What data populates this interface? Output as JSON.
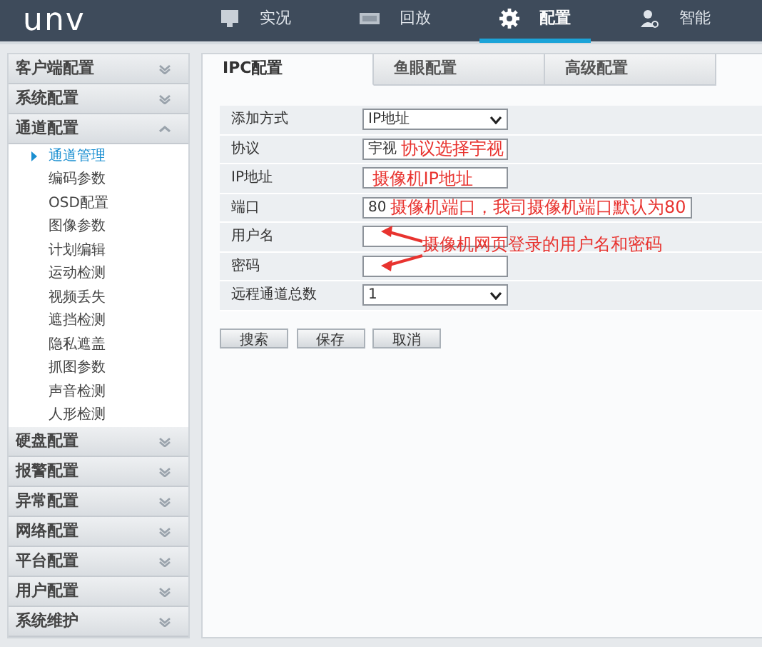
{
  "header": {
    "logo": "unv",
    "nav": [
      {
        "label": "实况",
        "selected": false
      },
      {
        "label": "回放",
        "selected": false
      },
      {
        "label": "配置",
        "selected": true
      },
      {
        "label": "智能",
        "selected": false
      }
    ]
  },
  "sidebar": [
    {
      "label": "客户端配置",
      "expanded": false
    },
    {
      "label": "系统配置",
      "expanded": false
    },
    {
      "label": "通道配置",
      "expanded": true,
      "children": [
        {
          "label": "通道管理",
          "selected": true
        },
        {
          "label": "编码参数",
          "selected": false
        },
        {
          "label": "OSD配置",
          "selected": false
        },
        {
          "label": "图像参数",
          "selected": false
        },
        {
          "label": "计划编辑",
          "selected": false
        },
        {
          "label": "运动检测",
          "selected": false
        },
        {
          "label": "视频丢失",
          "selected": false
        },
        {
          "label": "遮挡检测",
          "selected": false
        },
        {
          "label": "隐私遮盖",
          "selected": false
        },
        {
          "label": "抓图参数",
          "selected": false
        },
        {
          "label": "声音检测",
          "selected": false
        },
        {
          "label": "人形检测",
          "selected": false
        }
      ]
    },
    {
      "label": "硬盘配置",
      "expanded": false
    },
    {
      "label": "报警配置",
      "expanded": false
    },
    {
      "label": "异常配置",
      "expanded": false
    },
    {
      "label": "网络配置",
      "expanded": false
    },
    {
      "label": "平台配置",
      "expanded": false
    },
    {
      "label": "用户配置",
      "expanded": false
    },
    {
      "label": "系统维护",
      "expanded": false
    }
  ],
  "tabs": [
    {
      "label": "IPC配置",
      "selected": true
    },
    {
      "label": "鱼眼配置",
      "selected": false
    },
    {
      "label": "高级配置",
      "selected": false
    }
  ],
  "form": {
    "rows": [
      {
        "label": "添加方式",
        "kind": "select",
        "value": "IP地址"
      },
      {
        "label": "协议",
        "kind": "select",
        "value": "宇视",
        "annotation": "协议选择宇视"
      },
      {
        "label": "IP地址",
        "kind": "text",
        "annotation": "摄像机IP地址"
      },
      {
        "label": "端口",
        "kind": "text",
        "value": "80",
        "annotation": "摄像机端口，我司摄像机端口默认为80"
      },
      {
        "label": "用户名",
        "kind": "text"
      },
      {
        "label": "密码",
        "kind": "password"
      },
      {
        "label": "远程通道总数",
        "kind": "select",
        "value": "1"
      }
    ],
    "note": "摄像机网页登录的用户名和密码"
  },
  "buttons": [
    "搜索",
    "保存",
    "取消"
  ]
}
